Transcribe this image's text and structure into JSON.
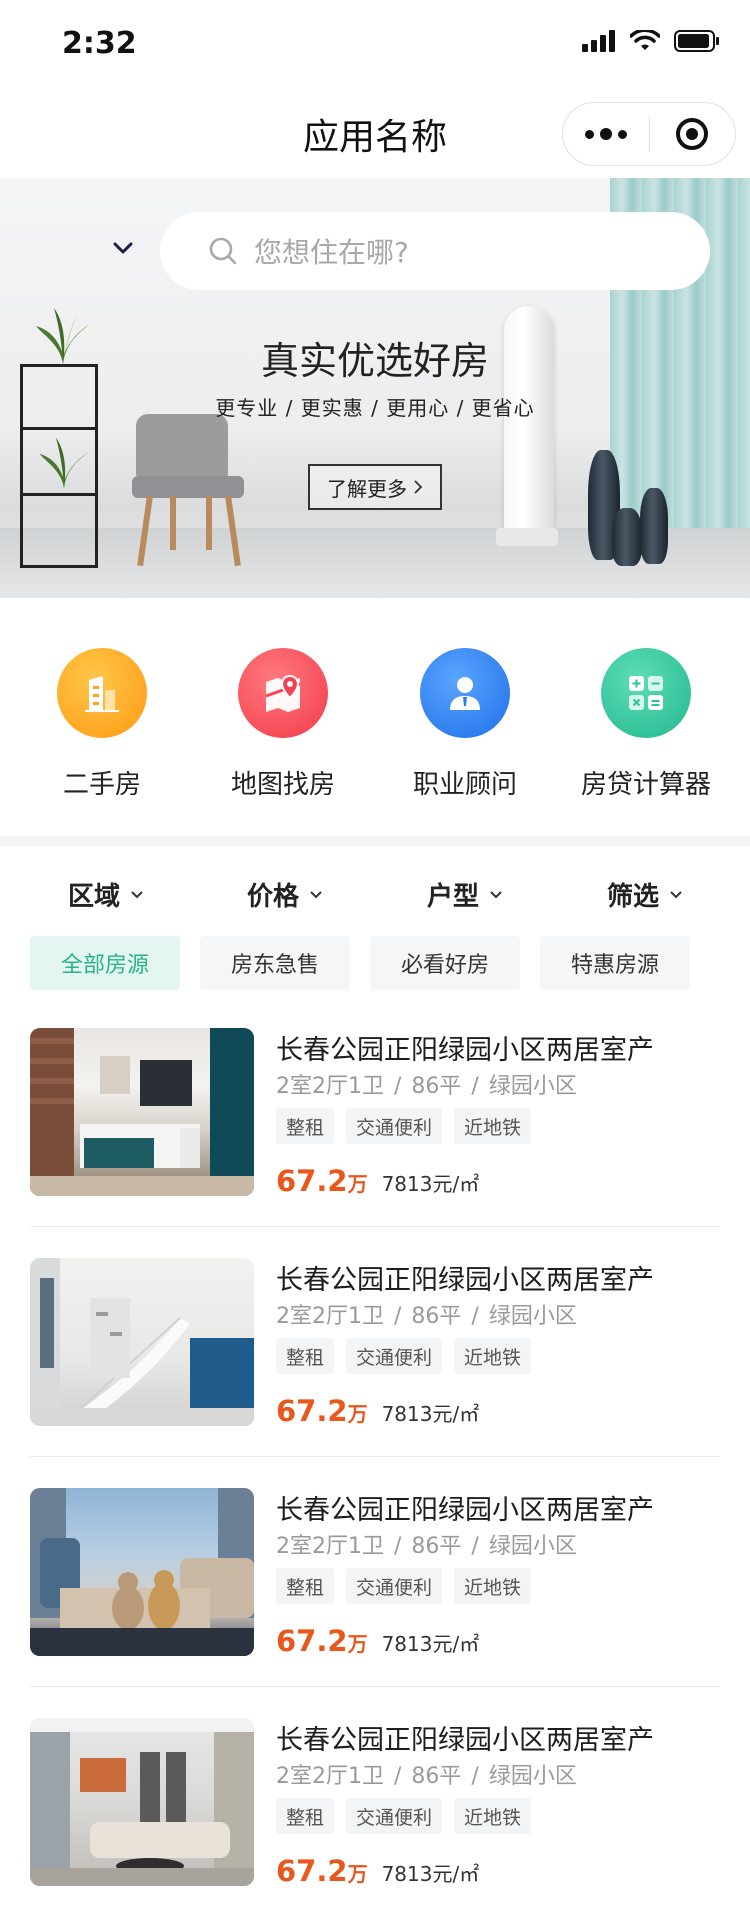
{
  "status_bar": {
    "time": "2:32"
  },
  "nav": {
    "title": "应用名称"
  },
  "search": {
    "placeholder": "您想住在哪?"
  },
  "banner": {
    "headline": "真实优选好房",
    "subline": "更专业 / 更实惠 / 更用心 / 更省心",
    "button_label": "了解更多"
  },
  "categories": [
    {
      "label": "二手房",
      "icon": "building-icon",
      "color": "#ffa31a"
    },
    {
      "label": "地图找房",
      "icon": "map-pin-icon",
      "color": "#f5424e"
    },
    {
      "label": "职业顾问",
      "icon": "agent-icon",
      "color": "#2a7ef0"
    },
    {
      "label": "房贷计算器",
      "icon": "calculator-icon",
      "color": "#2cc39a"
    }
  ],
  "filters": [
    {
      "label": "区域"
    },
    {
      "label": "价格"
    },
    {
      "label": "户型"
    },
    {
      "label": "筛选"
    }
  ],
  "tags": [
    {
      "label": "全部房源",
      "active": true
    },
    {
      "label": "房东急售",
      "active": false
    },
    {
      "label": "必看好房",
      "active": false
    },
    {
      "label": "特惠房源",
      "active": false
    }
  ],
  "colors": {
    "accent": "#2bb28d",
    "price": "#e8581d"
  },
  "listings": [
    {
      "title": "长春公园正阳绿园小区两居室产",
      "layout": "2室2厅1卫",
      "area": "86平",
      "community": "绿园小区",
      "tags": [
        "整租",
        "交通便利",
        "近地铁"
      ],
      "price": "67.2",
      "price_unit": "万",
      "unit_price": "7813元/㎡"
    },
    {
      "title": "长春公园正阳绿园小区两居室产",
      "layout": "2室2厅1卫",
      "area": "86平",
      "community": "绿园小区",
      "tags": [
        "整租",
        "交通便利",
        "近地铁"
      ],
      "price": "67.2",
      "price_unit": "万",
      "unit_price": "7813元/㎡"
    },
    {
      "title": "长春公园正阳绿园小区两居室产",
      "layout": "2室2厅1卫",
      "area": "86平",
      "community": "绿园小区",
      "tags": [
        "整租",
        "交通便利",
        "近地铁"
      ],
      "price": "67.2",
      "price_unit": "万",
      "unit_price": "7813元/㎡"
    },
    {
      "title": "长春公园正阳绿园小区两居室产",
      "layout": "2室2厅1卫",
      "area": "86平",
      "community": "绿园小区",
      "tags": [
        "整租",
        "交通便利",
        "近地铁"
      ],
      "price": "67.2",
      "price_unit": "万",
      "unit_price": "7813元/㎡"
    }
  ]
}
